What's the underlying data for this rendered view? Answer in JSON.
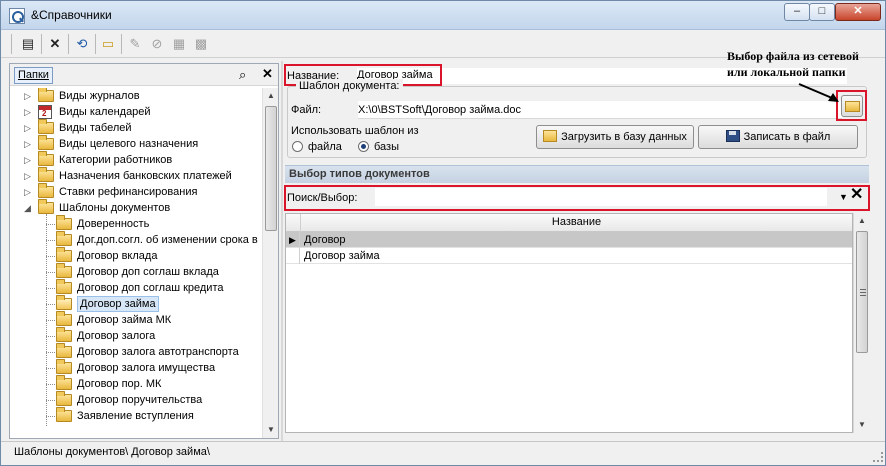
{
  "window": {
    "title": "&Справочники",
    "min": "–",
    "max": "□",
    "close": "✕"
  },
  "toolbar": {
    "new": "▤",
    "delete": "✕",
    "refresh": "⟲",
    "open": "▭",
    "t5": "✎",
    "t6": "⊘",
    "t7": "▦",
    "t8": "▩"
  },
  "left_panel": {
    "tab_label": "Папки",
    "tree": [
      {
        "label": "Виды журналов",
        "icon": "folder-icon",
        "level": 0,
        "expander": "▷"
      },
      {
        "label": "Виды календарей",
        "icon": "calendar-icon",
        "level": 0,
        "expander": "▷"
      },
      {
        "label": "Виды табелей",
        "icon": "folder-icon",
        "level": 0,
        "expander": "▷"
      },
      {
        "label": "Виды целевого назначения",
        "icon": "folder-icon",
        "level": 0,
        "expander": "▷"
      },
      {
        "label": "Категории работников",
        "icon": "folder-icon",
        "level": 0,
        "expander": "▷"
      },
      {
        "label": "Назначения банковских платежей",
        "icon": "folder-icon",
        "level": 0,
        "expander": "▷"
      },
      {
        "label": "Ставки рефинансирования",
        "icon": "folder-icon",
        "level": 0,
        "expander": "▷"
      },
      {
        "label": "Шаблоны документов",
        "icon": "folder-icon",
        "level": 0,
        "expander": "◢"
      },
      {
        "label": "Доверенность",
        "icon": "folder-icon",
        "level": 1
      },
      {
        "label": "Дог.доп.согл. об изменении срока в",
        "icon": "folder-icon",
        "level": 1
      },
      {
        "label": "Договор вклада",
        "icon": "folder-icon",
        "level": 1
      },
      {
        "label": "Договор доп соглаш вклада",
        "icon": "folder-icon",
        "level": 1
      },
      {
        "label": "Договор доп соглаш кредита",
        "icon": "folder-icon",
        "level": 1
      },
      {
        "label": "Договор займа",
        "icon": "folder-open-icon",
        "level": 1,
        "selected": true
      },
      {
        "label": "Договор займа МК",
        "icon": "folder-icon",
        "level": 1
      },
      {
        "label": "Договор залога",
        "icon": "folder-icon",
        "level": 1
      },
      {
        "label": "Договор залога автотранспорта",
        "icon": "folder-icon",
        "level": 1
      },
      {
        "label": "Договор залога имущества",
        "icon": "folder-icon",
        "level": 1
      },
      {
        "label": "Договор пор. МК",
        "icon": "folder-icon",
        "level": 1
      },
      {
        "label": "Договор поручительства",
        "icon": "folder-icon",
        "level": 1
      },
      {
        "label": "Заявление вступления",
        "icon": "folder-icon",
        "level": 1
      }
    ]
  },
  "form": {
    "name_label": "Название:",
    "name_value": "Договор займа",
    "template_group_title": "Шаблон документа:",
    "file_label": "Файл:",
    "file_value": "X:\\0\\BSTSoft\\Договор займа.doc",
    "use_template_label": "Использовать шаблон из",
    "radio_file": "файла",
    "radio_db": "базы",
    "radio_selected": "db",
    "load_button": "Загрузить в базу данных",
    "save_button": "Записать в файл"
  },
  "doc_types": {
    "section_title": "Выбор типов документов",
    "search_label": "Поиск/Выбор:",
    "search_value": "",
    "column_header": "Название",
    "rows": [
      {
        "name": "Договор",
        "selected": true
      },
      {
        "name": "Договор займа",
        "selected": false
      }
    ]
  },
  "annotation": {
    "text_line1": "Выбор файла из сетевой",
    "text_line2": "или локальной папки"
  },
  "status": {
    "path": "Шаблоны документов\\ Договор займа\\"
  },
  "colors": {
    "highlight_box": "#d9142b",
    "selected_row": "#c7c7c7"
  }
}
